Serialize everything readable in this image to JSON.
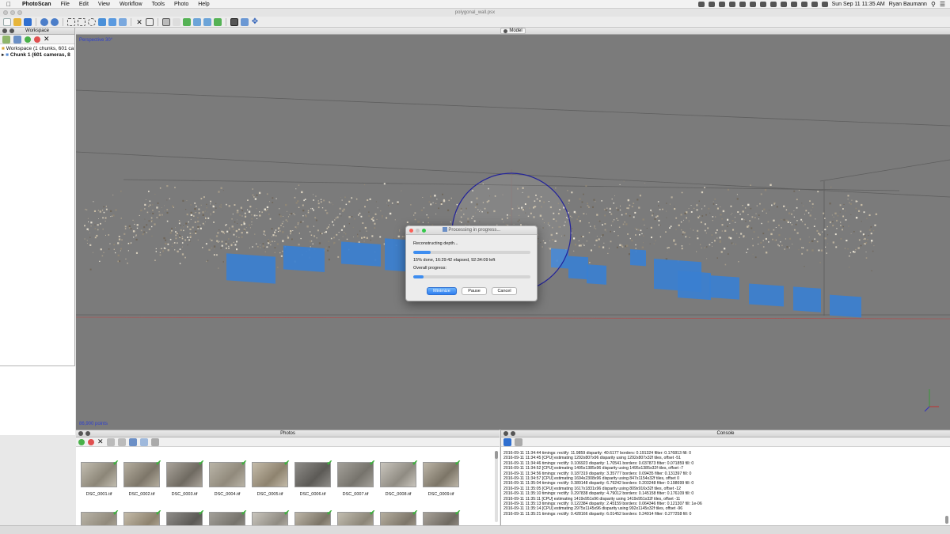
{
  "menubar": {
    "app_name": "PhotoScan",
    "items": [
      "File",
      "Edit",
      "View",
      "Workflow",
      "Tools",
      "Photo",
      "Help"
    ],
    "clock": "Sun Sep 11  11:35 AM",
    "user": "Ryan Baumann"
  },
  "window": {
    "title": "polygonal_wall.psx"
  },
  "workspace": {
    "title": "Workspace",
    "root": "Workspace (1 chunks, 601 ca",
    "chunk": "Chunk 1 (601 cameras, 8"
  },
  "viewport": {
    "tab_label": "Model",
    "projection": "Perspective 30°",
    "points": "86,900 points"
  },
  "dialog": {
    "title": "Processing in progress...",
    "stage": "Reconstructing depth...",
    "stage_progress": 0.15,
    "status": "15% done, 16:29:42 elapsed, 92:34:09 left",
    "overall_label": "Overall progress:",
    "overall_progress": 0.09,
    "buttons": {
      "minimize": "Minimize",
      "pause": "Pause",
      "cancel": "Cancel"
    }
  },
  "photos": {
    "title": "Photos",
    "items": [
      {
        "label": "DSC_0001.tif"
      },
      {
        "label": "DSC_0002.tif"
      },
      {
        "label": "DSC_0003.tif"
      },
      {
        "label": "DSC_0004.tif"
      },
      {
        "label": "DSC_0005.tif"
      },
      {
        "label": "DSC_0006.tif"
      },
      {
        "label": "DSC_0007.tif"
      },
      {
        "label": "DSC_0008.tif"
      },
      {
        "label": "DSC_0009.tif"
      }
    ]
  },
  "console": {
    "title": "Console",
    "lines": [
      "2016-09-11 11:34:44 timings: rectify: 11.9859 disparity: 40.6177 borders: 0.191324 filter: 0.176813 fill: 0",
      "2016-09-11 11:34:45 [CPU] estimating 1292x807x96 disparity using 1292x807x32f tiles, offset -51",
      "2016-09-11 11:34:46 timings: rectify: 0.106923 disparity: 1.70541 borders: 0.037873 filter: 0.071859 fill: 0",
      "2016-09-11 11:34:52 [CPU] estimating 1495x1385x96 disparity using 1495x1385x32f tiles, offset -7",
      "2016-09-11 11:34:56 timings: rectify: 0.187319 disparity: 3.35777 borders: 0.09435 filter: 0.131397 fill: 0",
      "2016-09-11 11:34:57 [CPU] estimating 1694x2308x96 disparity using 847x1154x32f tiles, offset 0",
      "2016-09-11 11:35:04 timings: rectify: 0.389148 disparity: 6.79242 borders: 0.203248 filter: 0.198699 fill: 0",
      "2016-09-11 11:35:05 [CPU] estimating 1617x1831x96 disparity using 809x916x32f tiles, offset -12",
      "2016-09-11 11:35:10 timings: rectify: 0.297838 disparity: 4.79012 borders: 0.145158 filter: 0.176109 fill: 0",
      "2016-09-11 11:35:11 [CPU] estimating 1419x951x96 disparity using 1419x951x32f tiles, offset -11",
      "2016-09-11 11:35:13 timings: rectify: 0.122384 disparity: 2.45159 borders: 0.064346 filter: 0.121307 fill: 1e-06",
      "2016-09-11 11:35:14 [CPU] estimating 2975x1145x96 disparity using 992x1145x32f tiles, offset -96",
      "2016-09-11 11:35:21 timings: rectify: 0.428166 disparity: 6.01452 borders: 0.24914 filter: 0.277258 fill: 0"
    ]
  },
  "colors": {
    "accent": "#3d8df0",
    "camera_blue": "#3a7fd0",
    "overlay_text": "#2d3fcf",
    "viewport_bg": "#7b7b7b"
  },
  "icons": [
    "apple-icon",
    "new-icon",
    "open-icon",
    "save-icon",
    "undo-icon",
    "redo-icon",
    "select-icon",
    "navigate-icon",
    "camera-icon",
    "close-icon",
    "check-icon",
    "x-axis-icon",
    "y-axis-icon",
    "z-axis-icon"
  ]
}
